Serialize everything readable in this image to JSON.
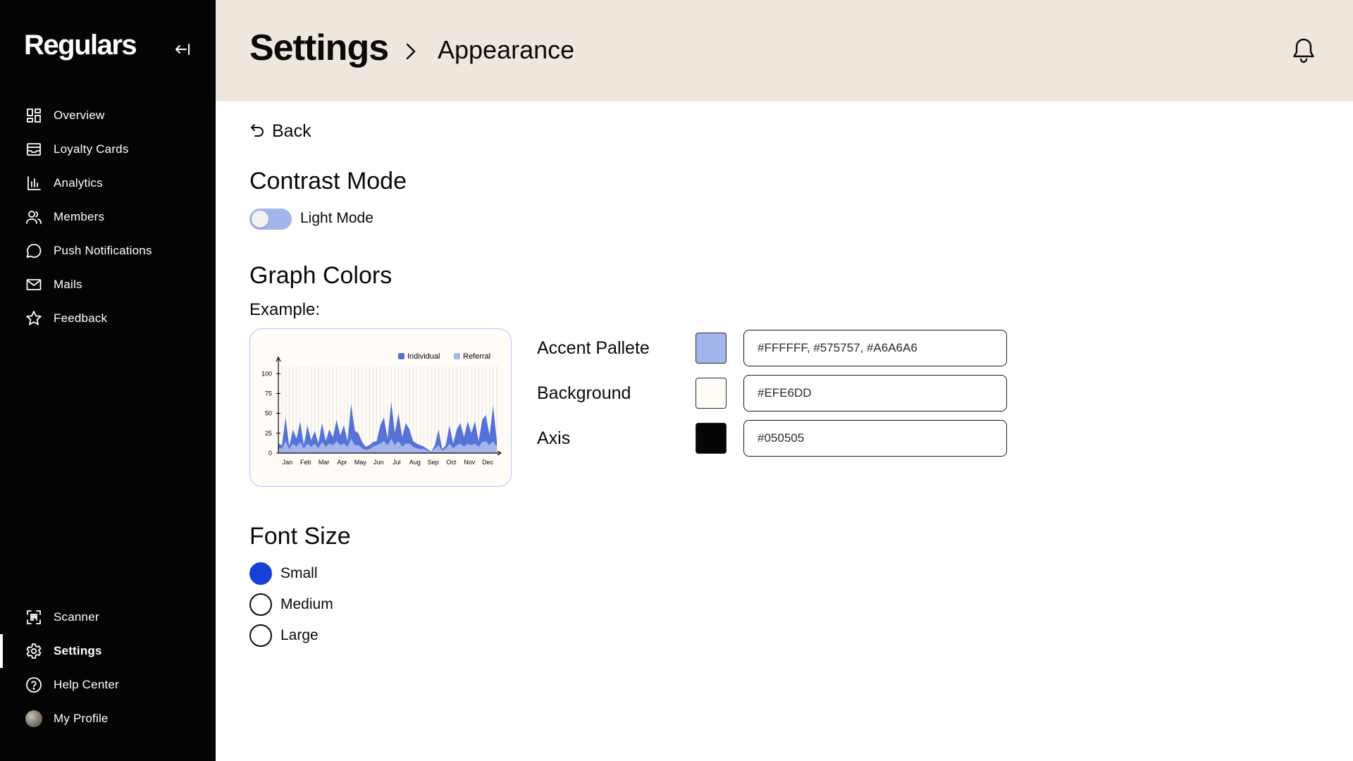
{
  "app": {
    "brand": "Regulars"
  },
  "sidebar": {
    "items": [
      {
        "label": "Overview",
        "icon": "grid-icon"
      },
      {
        "label": "Loyalty Cards",
        "icon": "inbox-icon"
      },
      {
        "label": "Analytics",
        "icon": "bar-chart-icon"
      },
      {
        "label": "Members",
        "icon": "users-icon"
      },
      {
        "label": "Push Notifications",
        "icon": "chat-bubble-icon"
      },
      {
        "label": "Mails",
        "icon": "mail-icon"
      },
      {
        "label": "Feedback",
        "icon": "star-icon"
      }
    ],
    "bottom_items": [
      {
        "label": "Scanner",
        "icon": "scan-icon"
      },
      {
        "label": "Settings",
        "icon": "gear-icon",
        "active": true
      },
      {
        "label": "Help Center",
        "icon": "help-circle-icon"
      },
      {
        "label": "My Profile",
        "icon": "avatar"
      }
    ]
  },
  "header": {
    "breadcrumb_root": "Settings",
    "breadcrumb_current": "Appearance"
  },
  "main": {
    "back_label": "Back",
    "contrast": {
      "title": "Contrast Mode",
      "toggle_label": "Light Mode",
      "enabled": false
    },
    "graph_colors": {
      "title": "Graph Colors",
      "example_label": "Example:",
      "rows": [
        {
          "label": "Accent Pallete",
          "value": "#FFFFFF, #575757, #A6A6A6",
          "swatch": "#a3b6ec"
        },
        {
          "label": "Background",
          "value": "#EFE6DD",
          "swatch": "#fffcf8"
        },
        {
          "label": "Axis",
          "value": "#050505",
          "swatch": "#050505"
        }
      ]
    },
    "font_size": {
      "title": "Font Size",
      "options": [
        "Small",
        "Medium",
        "Large"
      ],
      "selected": "Small"
    }
  },
  "colors": {
    "sidebar_bg": "#050505",
    "header_bg": "#efe6dd",
    "accent": "#1640d6",
    "series_individual": "#5672d8",
    "series_referral": "#a3b6ec"
  },
  "chart_data": {
    "type": "area",
    "legend": [
      "Individual",
      "Referral"
    ],
    "categories": [
      "Jan",
      "Feb",
      "Mar",
      "Apr",
      "May",
      "Jun",
      "Jul",
      "Aug",
      "Sep",
      "Oct",
      "Nov",
      "Dec"
    ],
    "yticks": [
      0,
      25,
      50,
      75,
      100
    ],
    "ylim": [
      0,
      110
    ],
    "series": [
      {
        "name": "Individual",
        "values": [
          12,
          10,
          45,
          8,
          30,
          18,
          40,
          10,
          35,
          16,
          28,
          12,
          38,
          15,
          30,
          20,
          42,
          22,
          35,
          15,
          62,
          28,
          25,
          14,
          8,
          10,
          14,
          15,
          35,
          45,
          18,
          65,
          25,
          50,
          20,
          38,
          30,
          15,
          12,
          10,
          8,
          5,
          2,
          10,
          30,
          5,
          10,
          35,
          12,
          30,
          38,
          20,
          40,
          25,
          40,
          15,
          42,
          48,
          22,
          60,
          15
        ]
      },
      {
        "name": "Referral",
        "values": [
          6,
          6,
          15,
          5,
          12,
          8,
          14,
          6,
          12,
          8,
          12,
          6,
          14,
          8,
          12,
          10,
          15,
          10,
          12,
          8,
          18,
          10,
          10,
          6,
          4,
          5,
          8,
          10,
          12,
          15,
          10,
          18,
          10,
          15,
          8,
          12,
          12,
          8,
          6,
          5,
          5,
          3,
          2,
          6,
          10,
          3,
          6,
          12,
          6,
          10,
          12,
          8,
          12,
          10,
          12,
          8,
          14,
          15,
          10,
          15,
          8
        ]
      }
    ]
  }
}
